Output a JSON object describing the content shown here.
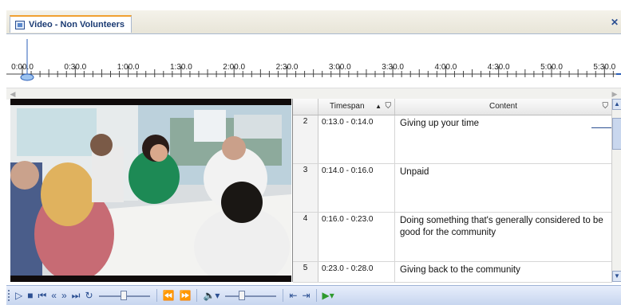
{
  "document_tab": {
    "title": "Video - Non Volunteers",
    "icon": "video-document-icon",
    "close_icon": "close-icon"
  },
  "timeline": {
    "labels": [
      "0:00.0",
      "0:30.0",
      "1:00.0",
      "1:30.0",
      "2:00.0",
      "2:30.0",
      "3:00.0",
      "3:30.0",
      "4:00.0",
      "4:30.0",
      "5:00.0",
      "5:30.0"
    ],
    "position": "0:00.0"
  },
  "grid": {
    "headers": {
      "timespan": "Timespan",
      "content": "Content"
    },
    "sort_icon": "sort-ascending-icon",
    "filter_icon": "filter-icon",
    "rows": [
      {
        "num": "2",
        "timespan": "0:13.0 - 0:14.0",
        "content": "Giving up your time"
      },
      {
        "num": "3",
        "timespan": "0:14.0 - 0:16.0",
        "content": "Unpaid"
      },
      {
        "num": "4",
        "timespan": "0:16.0 - 0:23.0",
        "content": "Doing something that's generally considered to be good for the community"
      },
      {
        "num": "5",
        "timespan": "0:23.0 - 0:28.0",
        "content": "Giving back to the community"
      }
    ]
  },
  "toolbar": {
    "buttons": [
      "play-icon",
      "stop-icon",
      "go-to-start-icon",
      "rewind-icon",
      "fast-forward-icon",
      "go-to-end-icon",
      "loop-icon",
      "previous-segment-icon",
      "next-segment-icon",
      "volume-icon",
      "merge-left-icon",
      "merge-right-icon",
      "play-options-icon"
    ],
    "speed_slider": 0.45,
    "volume_slider": 0.3,
    "accent": "#2b4f92",
    "play_color": "#2e9a2e"
  }
}
